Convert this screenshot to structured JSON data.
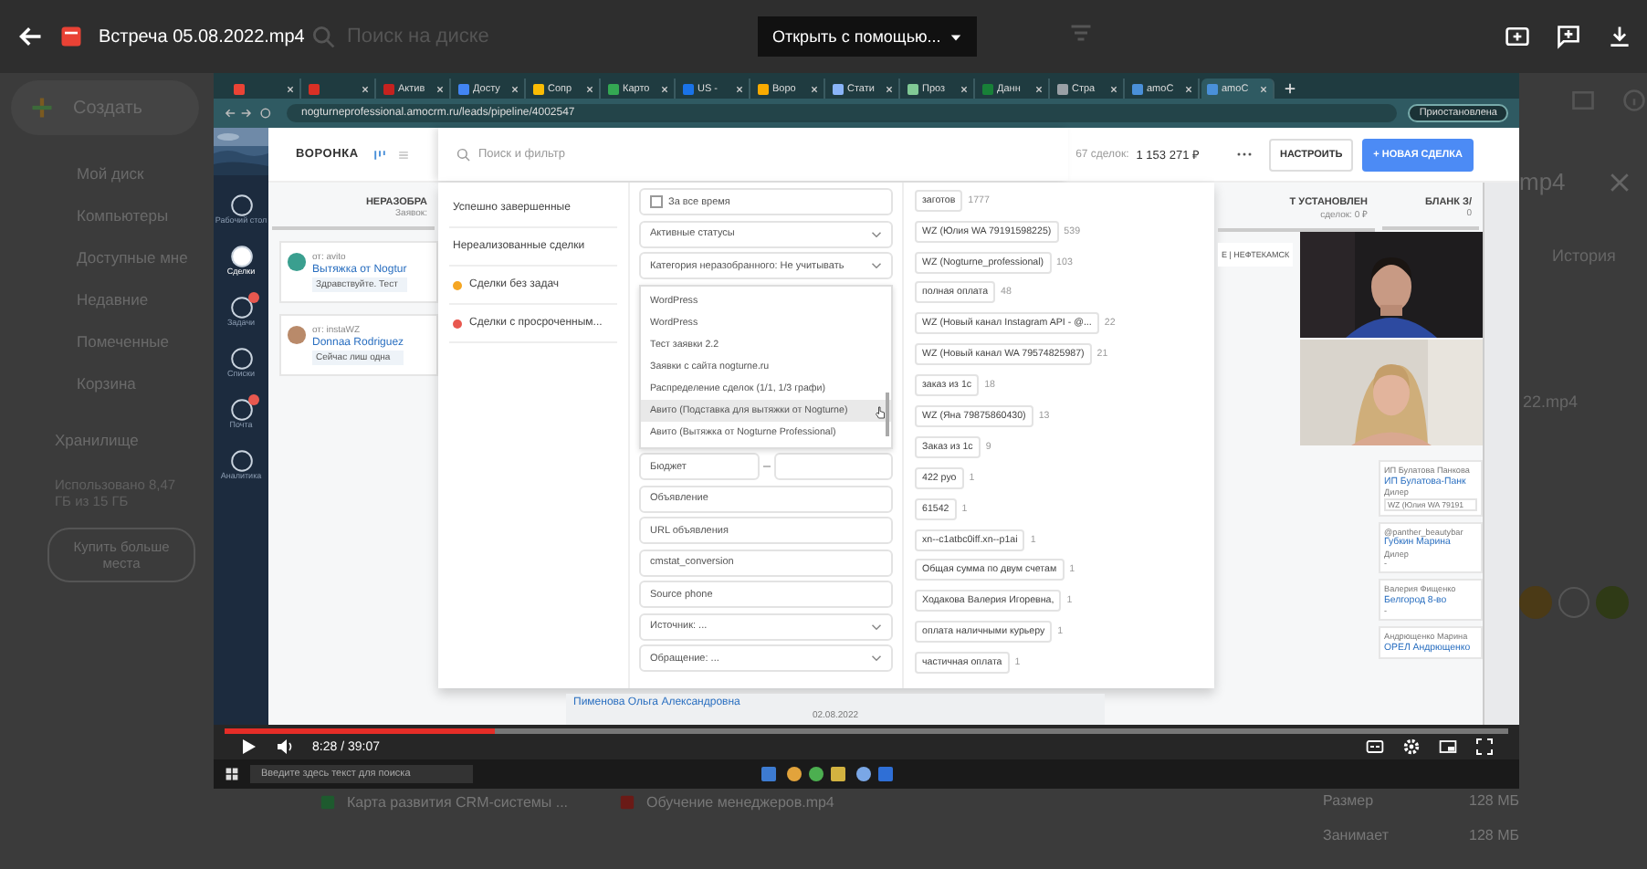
{
  "topbar": {
    "title": "Встреча 05.08.2022.mp4",
    "search_placeholder": "Поиск на диске",
    "open_with": "Открыть с помощью..."
  },
  "drive_nav": {
    "create": "Создать",
    "items": [
      "Мой диск",
      "Компьютеры",
      "Доступные мне",
      "Недавние",
      "Помеченные",
      "Корзина"
    ],
    "storage": "Хранилище",
    "usage": "Использовано 8,47 ГБ из 15 ГБ",
    "buy": "Купить больше места"
  },
  "details": {
    "title": "mp4",
    "tab": "История",
    "file": "22.mp4"
  },
  "files": [
    {
      "name": "Карта развития CRM-системы ...",
      "kind": "sheet"
    },
    {
      "name": "Обучение менеджеров.mp4",
      "kind": "video"
    }
  ],
  "file_info": [
    {
      "label": "Размер",
      "value": "128 МБ"
    },
    {
      "label": "Занимает",
      "value": "128 МБ"
    }
  ],
  "video": {
    "browser": {
      "tabs": [
        {
          "color": "#ea4335",
          "selected": false
        },
        {
          "color": "#d93025",
          "selected": false
        },
        {
          "title": "Актив",
          "color": "#c5221f",
          "selected": false
        },
        {
          "title": "Досту",
          "color": "#4285f4",
          "selected": false
        },
        {
          "title": "Сопр",
          "color": "#fbbc04",
          "selected": false
        },
        {
          "title": "Карто",
          "color": "#34a853",
          "selected": false
        },
        {
          "title": "US -",
          "color": "#1a73e8",
          "selected": false
        },
        {
          "title": "Воро",
          "color": "#f9ab00",
          "selected": false
        },
        {
          "title": "Стати",
          "color": "#8ab4f8",
          "selected": false
        },
        {
          "title": "Проз",
          "color": "#81c995",
          "selected": false
        },
        {
          "title": "Данн",
          "color": "#188038",
          "selected": false
        },
        {
          "title": "Стра",
          "color": "#9aa0a6",
          "selected": false
        },
        {
          "title": "amoC",
          "color": "#4a90d9",
          "selected": false
        },
        {
          "title": "amoC",
          "color": "#4a90d9",
          "selected": true
        }
      ],
      "url": "nogturneprofessional.amocrm.ru/leads/pipeline/4002547",
      "profile": "Приостановлена"
    },
    "crm": {
      "sidebar": [
        {
          "label": "Рабочий стол",
          "selected": false,
          "badge": false
        },
        {
          "label": "Сделки",
          "selected": true,
          "badge": false
        },
        {
          "label": "Задачи",
          "selected": false,
          "badge": true
        },
        {
          "label": "Списки",
          "selected": false,
          "badge": false
        },
        {
          "label": "Почта",
          "selected": false,
          "badge": true
        },
        {
          "label": "Аналитика",
          "selected": false,
          "badge": false
        }
      ],
      "title": "ВОРОНКА",
      "search_placeholder": "Поиск и фильтр",
      "deal_count": "67 сделок:",
      "deal_sum": "1 153 271 ₽",
      "configure": "НАСТРОИТЬ",
      "new_deal": "+ НОВАЯ СДЕЛКА",
      "left_column": {
        "title": "НЕРАЗОБРА",
        "subtitle": "Заявок:",
        "cards": [
          {
            "source": "от: avito",
            "title": "Вытяжка от Nogtur",
            "message": "Здравствуйте. Тест"
          },
          {
            "source": "от: instaWZ",
            "title": "Donnaa Rodriguez",
            "message": "Сейчас лиш одна"
          }
        ]
      },
      "filter": {
        "presets": [
          {
            "label": "Успешно завершенные"
          },
          {
            "label": "Нереализованные сделки"
          },
          {
            "label": "Сделки без задач",
            "color": "#f5a623"
          },
          {
            "label": "Сделки с просроченным...",
            "color": "#e8584f"
          }
        ],
        "fields": [
          {
            "kind": "checkbox",
            "label": "За все время",
            "checked": false
          },
          {
            "kind": "select",
            "label": "Активные статусы"
          },
          {
            "kind": "select",
            "label": "Категория неразобранного: Не учитывать"
          },
          {
            "kind": "dropdown",
            "options": [
              {
                "label": "WordPress",
                "selected": false
              },
              {
                "label": "WordPress",
                "selected": false
              },
              {
                "label": "Тест заявки 2.2",
                "selected": false
              },
              {
                "label": "Заявки с сайта nogturne.ru",
                "selected": false
              },
              {
                "label": "Распределение сделок (1/1, 1/3 графи)",
                "selected": false
              },
              {
                "label": "Авито (Подставка для вытяжки от Nogturne)",
                "selected": true
              },
              {
                "label": "Авито (Вытяжка от Nogturne Professional)",
                "selected": false
              }
            ]
          },
          {
            "kind": "pair",
            "placeholder": "Бюджет"
          },
          {
            "kind": "input",
            "placeholder": "Объявление"
          },
          {
            "kind": "input",
            "placeholder": "URL объявления"
          },
          {
            "kind": "input",
            "placeholder": "cmstat_conversion"
          },
          {
            "kind": "input",
            "placeholder": "Source phone"
          },
          {
            "kind": "select",
            "label": "Источник: ..."
          },
          {
            "kind": "select",
            "label": "Обращение: ..."
          }
        ],
        "tags": [
          {
            "name": "заготов",
            "count": "1777"
          },
          {
            "name": "WZ (Юлия WA 79191598225)",
            "count": "539"
          },
          {
            "name": "WZ (Nogturne_professional)",
            "count": "103"
          },
          {
            "name": "полная оплата",
            "count": "48"
          },
          {
            "name": "WZ (Новый канал Instagram API - @...",
            "count": "22"
          },
          {
            "name": "WZ (Новый канал WA 79574825987)",
            "count": "21"
          },
          {
            "name": "заказ из 1с",
            "count": "18"
          },
          {
            "name": "WZ (Яна 79875860430)",
            "count": "13"
          },
          {
            "name": "Заказ из 1с",
            "count": "9"
          },
          {
            "name": "422 руо",
            "count": "1"
          },
          {
            "name": "61542",
            "count": "1"
          },
          {
            "name": "xn--c1atbc0iff.xn--p1ai",
            "count": "1"
          },
          {
            "name": "Общая сумма по двум счетам",
            "count": "1"
          },
          {
            "name": "Ходакова Валерия Игоревна,",
            "count": "1"
          },
          {
            "name": "оплата наличными курьеру",
            "count": "1"
          },
          {
            "name": "частичная оплата",
            "count": "1"
          }
        ]
      },
      "bottom_card": {
        "name": "Пименова Ольга Александровна",
        "date": "02.08.2022"
      },
      "middle_column": {
        "title": "Т УСТАНОВЛЕН",
        "subtitle": "сделок: 0 ₽",
        "card": "Е | НЕФТЕКАМСК"
      },
      "right_column": {
        "title": "БЛАНК З/",
        "subtitle": "0",
        "cards": [
          {
            "contact": "ИП Булатова Панкова",
            "title": "ИП Булатова-Панк",
            "role": "Дилер",
            "tag": "WZ (Юлия WA 79191"
          },
          {
            "contact": "@panther_beautybar",
            "title": "Губкин Марина",
            "role": "Дилер",
            "note": "-"
          },
          {
            "contact": "Валерия Фищенко",
            "title": "Белгород 8-во",
            "note": "-"
          },
          {
            "contact": "Андрющенко Марина",
            "title": "ОРЕЛ Андрющенко"
          }
        ]
      }
    },
    "player": {
      "level": 0.21,
      "time": "8:28 / 39:07"
    },
    "taskbar": {
      "search_placeholder": "Введите здесь текст для поиска"
    }
  }
}
